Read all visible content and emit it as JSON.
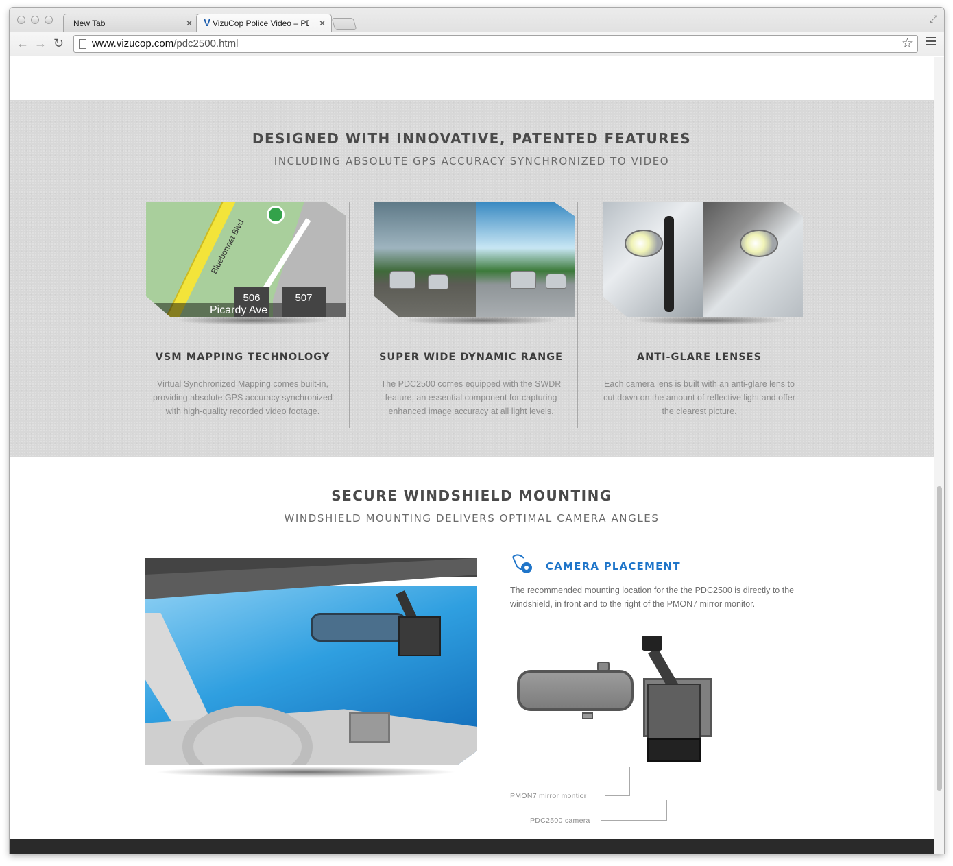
{
  "browser": {
    "tabs": [
      {
        "label": "New Tab",
        "active": false
      },
      {
        "label": "VizuCop Police Video – PDC",
        "active": true
      }
    ],
    "url_host": "www.vizucop.com",
    "url_path": "/pdc2500.html"
  },
  "features": {
    "title": "DESIGNED WITH INNOVATIVE, PATENTED FEATURES",
    "subtitle": "INCLUDING ABSOLUTE GPS ACCURACY SYNCHRONIZED TO VIDEO",
    "map": {
      "street": "Picardy Ave",
      "blvd": "Bluebonnet Blvd",
      "lot_a": "506",
      "lot_b": "507"
    },
    "columns": [
      {
        "title": "VSM MAPPING TECHNOLOGY",
        "text": "Virtual Synchronized Mapping comes built-in, providing absolute GPS accuracy synchronized with high-quality recorded video footage."
      },
      {
        "title": "SUPER WIDE DYNAMIC RANGE",
        "text": "The PDC2500 comes equipped with the SWDR feature, an essential component for capturing enhanced image accuracy at all light levels."
      },
      {
        "title": "ANTI-GLARE LENSES",
        "text": "Each camera lens is built with an anti-glare lens to cut down on the amount of reflective light and offer the clearest picture."
      }
    ]
  },
  "mounting": {
    "title": "SECURE WINDSHIELD MOUNTING",
    "subtitle": "WINDSHIELD MOUNTING DELIVERS OPTIMAL CAMERA ANGLES",
    "placement_title": "CAMERA PLACEMENT",
    "placement_text": "The recommended mounting location for the the PDC2500 is directly to the windshield, in front and to the right of the PMON7 mirror monitor.",
    "label_mirror": "PMON7 mirror montior",
    "label_camera": "PDC2500 camera"
  },
  "colors": {
    "accent": "#1f75c9",
    "section_bg": "#d8d8d8",
    "heading": "#4a4a4a"
  }
}
